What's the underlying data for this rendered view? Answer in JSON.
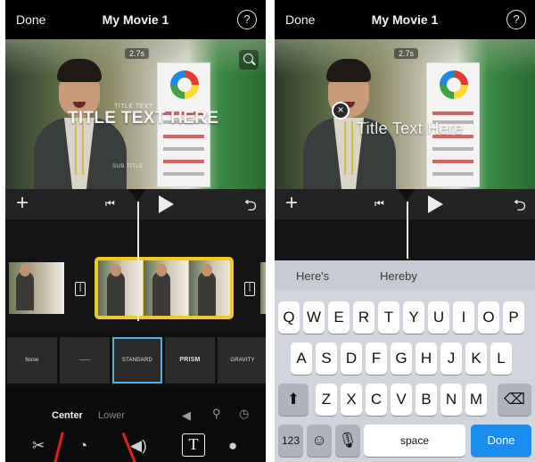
{
  "left": {
    "nav": {
      "done": "Done",
      "title": "My Movie 1",
      "help": "?"
    },
    "video": {
      "duration": "2.7s",
      "overlay_small": "TITLE TEXT",
      "overlay_title": "TITLE TEXT HERE",
      "overlay_sub": "SUB TITLE"
    },
    "controls": {
      "add": "+",
      "skip_back": "⏮",
      "undo": "⮌"
    },
    "styles": [
      "None",
      "——",
      "STANDARD",
      "PRISM",
      "GRAVITY"
    ],
    "position_options": [
      "Center",
      "Lower"
    ],
    "bottom_icons": [
      "mute-icon",
      "location-icon",
      "clock-icon"
    ],
    "tools": [
      "scissors-icon",
      "speed-icon",
      "volume-icon",
      "title-icon",
      "filter-icon"
    ]
  },
  "right": {
    "nav": {
      "done": "Done",
      "title": "My Movie 1",
      "help": "?"
    },
    "video": {
      "duration": "2.7s",
      "overlay_title": "Title Text Here"
    },
    "controls": {
      "add": "+",
      "skip_back": "⏮",
      "undo": "⮌"
    },
    "suggestions": [
      "Here's",
      "Hereby"
    ],
    "keyboard": {
      "row1": [
        "Q",
        "W",
        "E",
        "R",
        "T",
        "Y",
        "U",
        "I",
        "O",
        "P"
      ],
      "row2": [
        "A",
        "S",
        "D",
        "F",
        "G",
        "H",
        "J",
        "K",
        "L"
      ],
      "row3": [
        "Z",
        "X",
        "C",
        "V",
        "B",
        "N",
        "M"
      ],
      "numbers": "123",
      "space": "space",
      "done": "Done"
    }
  },
  "colors": {
    "selection": "#4ab3e8",
    "clip_border": "#f3c62a",
    "done_key": "#1a8cf0",
    "annotation_arrow": "#e02020"
  }
}
